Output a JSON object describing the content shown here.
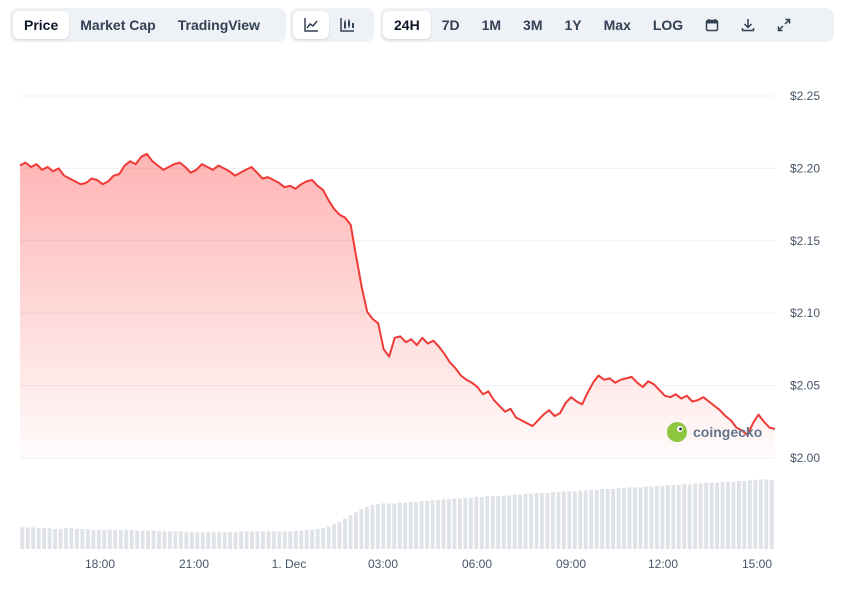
{
  "toolbar": {
    "metric_tabs": [
      "Price",
      "Market Cap",
      "TradingView"
    ],
    "active_metric": "Price",
    "chart_type_icons": [
      "line-chart-icon",
      "candlestick-chart-icon"
    ],
    "range_tabs": [
      "24H",
      "7D",
      "1M",
      "3M",
      "1Y",
      "Max",
      "LOG"
    ],
    "active_range": "24H",
    "tool_icons": [
      "calendar-icon",
      "download-icon",
      "fullscreen-icon"
    ]
  },
  "watermark": {
    "text": "coingecko"
  },
  "colors": {
    "line": "#ef3b36",
    "area": "#ff4d4d",
    "volume": "#dfe3e8",
    "grid": "#eef0f3"
  },
  "chart_data": {
    "type": "area",
    "title": "",
    "xlabel": "",
    "ylabel": "",
    "x_ticks": [
      "18:00",
      "21:00",
      "1. Dec",
      "03:00",
      "06:00",
      "09:00",
      "12:00",
      "15:00"
    ],
    "y_ticks": [
      "$2.00",
      "$2.05",
      "$2.10",
      "$2.15",
      "$2.20",
      "$2.25"
    ],
    "ylim": [
      2.0,
      2.25
    ],
    "grid": true,
    "series": [
      {
        "values": [
          2.202,
          2.204,
          2.201,
          2.203,
          2.199,
          2.201,
          2.198,
          2.2,
          2.195,
          2.193,
          2.191,
          2.189,
          2.19,
          2.193,
          2.192,
          2.189,
          2.191,
          2.195,
          2.196,
          2.202,
          2.205,
          2.203,
          2.208,
          2.21,
          2.205,
          2.202,
          2.199,
          2.201,
          2.203,
          2.204,
          2.201,
          2.197,
          2.199,
          2.203,
          2.201,
          2.199,
          2.202,
          2.2,
          2.198,
          2.195,
          2.197,
          2.199,
          2.201,
          2.197,
          2.193,
          2.194,
          2.192,
          2.19,
          2.187,
          2.188,
          2.186,
          2.189,
          2.191,
          2.192,
          2.188,
          2.185,
          2.178,
          2.172,
          2.168,
          2.166,
          2.161,
          2.139,
          2.118,
          2.101,
          2.096,
          2.093,
          2.075,
          2.07,
          2.083,
          2.084,
          2.08,
          2.082,
          2.078,
          2.083,
          2.079,
          2.081,
          2.077,
          2.072,
          2.066,
          2.062,
          2.057,
          2.054,
          2.052,
          2.049,
          2.044,
          2.046,
          2.04,
          2.036,
          2.032,
          2.034,
          2.028,
          2.026,
          2.024,
          2.022,
          2.026,
          2.03,
          2.033,
          2.029,
          2.031,
          2.038,
          2.042,
          2.039,
          2.037,
          2.045,
          2.052,
          2.057,
          2.054,
          2.055,
          2.052,
          2.054,
          2.055,
          2.056,
          2.052,
          2.049,
          2.053,
          2.051,
          2.047,
          2.043,
          2.042,
          2.044,
          2.041,
          2.043,
          2.039,
          2.04,
          2.042,
          2.039,
          2.036,
          2.033,
          2.029,
          2.026,
          2.021,
          2.019,
          2.016,
          2.024,
          2.03,
          2.025,
          2.021,
          2.02
        ]
      }
    ],
    "volume": [
      27,
      27,
      27,
      26,
      26,
      26,
      25,
      25,
      26,
      26,
      25,
      25,
      25,
      24,
      24,
      24,
      24,
      24,
      24,
      24,
      24,
      23,
      23,
      23,
      23,
      22,
      22,
      22,
      22,
      22,
      21,
      21,
      21,
      21,
      21,
      21,
      21,
      21,
      21,
      21,
      22,
      22,
      22,
      22,
      22,
      22,
      22,
      22,
      22,
      22,
      23,
      23,
      24,
      24,
      25,
      26,
      28,
      31,
      34,
      38,
      42,
      46,
      50,
      53,
      55,
      56,
      57,
      57,
      57,
      58,
      58,
      59,
      59,
      60,
      60,
      61,
      61,
      62,
      62,
      63,
      63,
      64,
      64,
      65,
      65,
      66,
      66,
      66,
      66,
      67,
      68,
      68,
      69,
      69,
      70,
      70,
      70,
      71,
      71,
      72,
      72,
      72,
      73,
      73,
      74,
      74,
      75,
      75,
      75,
      76,
      76,
      77,
      77,
      77,
      78,
      78,
      79,
      79,
      80,
      80,
      80,
      81,
      81,
      82,
      82,
      83,
      83,
      83,
      84,
      84,
      84,
      85,
      85,
      86,
      86,
      87,
      87,
      86
    ]
  }
}
